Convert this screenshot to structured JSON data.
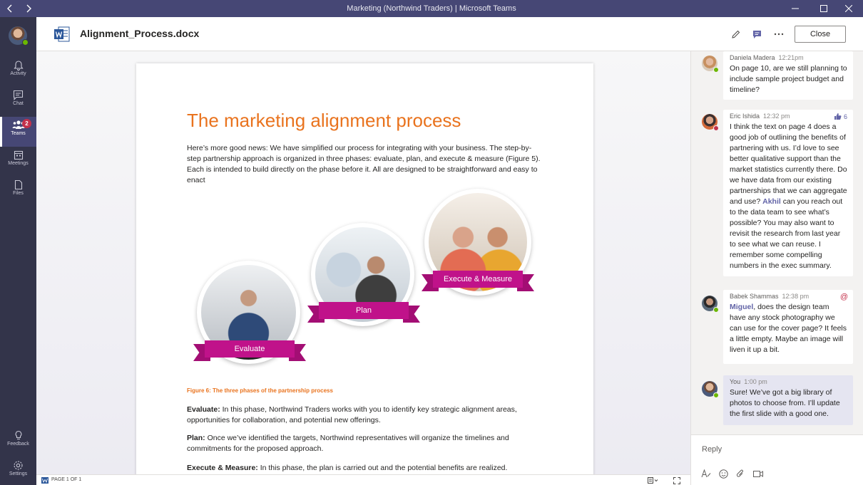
{
  "window": {
    "title": "Marketing (Northwind Traders) | Microsoft Teams"
  },
  "rail": {
    "items": [
      {
        "label": "Activity",
        "icon": "bell-icon"
      },
      {
        "label": "Chat",
        "icon": "chat-icon"
      },
      {
        "label": "Teams",
        "icon": "teams-icon",
        "badge": "2"
      },
      {
        "label": "Meetings",
        "icon": "calendar-icon"
      },
      {
        "label": "Files",
        "icon": "file-icon"
      },
      {
        "label": "Feedback",
        "icon": "lightbulb-icon"
      },
      {
        "label": "Settings",
        "icon": "gear-icon"
      }
    ]
  },
  "header": {
    "doc_name": "Alignment_Process.docx",
    "close_label": "Close"
  },
  "document": {
    "heading": "The marketing alignment process",
    "intro": "Here’s more good news: We have simplified our process for integrating with your business. The step-by-step partnership approach is organized in three phases: evaluate, plan, and execute & measure (Figure 5). Each is intended to build directly on the phase before it. All are designed to be straightforward and easy to enact",
    "phases": [
      "Evaluate",
      "Plan",
      "Execute & Measure"
    ],
    "caption": "Figure 6: The three phases of the partnership process",
    "paragraphs": [
      {
        "term": "Evaluate:",
        "text": " In this phase, Northwind Traders works with you to identify key strategic alignment areas, opportunities for collaboration, and potential new offerings."
      },
      {
        "term": "Plan:",
        "text": " Once we’ve identified the targets, Northwind representatives will organize the timelines and commitments for the proposed approach."
      },
      {
        "term": "Execute & Measure:",
        "text": " In this phase, the plan is carried out and the potential benefits are realized."
      }
    ]
  },
  "statusbar": {
    "page": "PAGE 1 OF 1"
  },
  "comments": [
    {
      "author": "Daniela Madera",
      "time": "12:21pm",
      "text": "On page 10, are we still planning to include sample project budget and timeline?"
    },
    {
      "author": "Eric Ishida",
      "time": "12:32 pm",
      "likes": "6",
      "text_a": "I think the text on page 4 does a good job of outlining the benefits of partnering with us.  I’d love to see better qualitative support than the market statistics currently there. Do we have data from our existing partnerships that we can aggregate and use?  ",
      "mention": "Akhil",
      "text_b": " can you reach out to the data team to see what’s possible?  You may also want to revisit the research from last year to see what we can reuse. I remember some compelling numbers in the exec summary."
    },
    {
      "author": "Babek Shammas",
      "time": "12:38 pm",
      "at": "@",
      "mention": "Miguel",
      "text": ", does the design team have any stock photography we can use for the cover page?  It feels a little empty. Maybe an image will liven it up a bit."
    },
    {
      "author": "You",
      "time": "1:00 pm",
      "text": "Sure! We’ve got a big library of photos to choose from. I’ll update the first slide with a good one."
    }
  ],
  "reply": {
    "placeholder": "Reply"
  },
  "colors": {
    "titlebar": "#464775",
    "rail": "#33344a",
    "accent": "#6264a7",
    "heading_orange": "#e9731e",
    "ribbon_magenta": "#c0128a"
  }
}
